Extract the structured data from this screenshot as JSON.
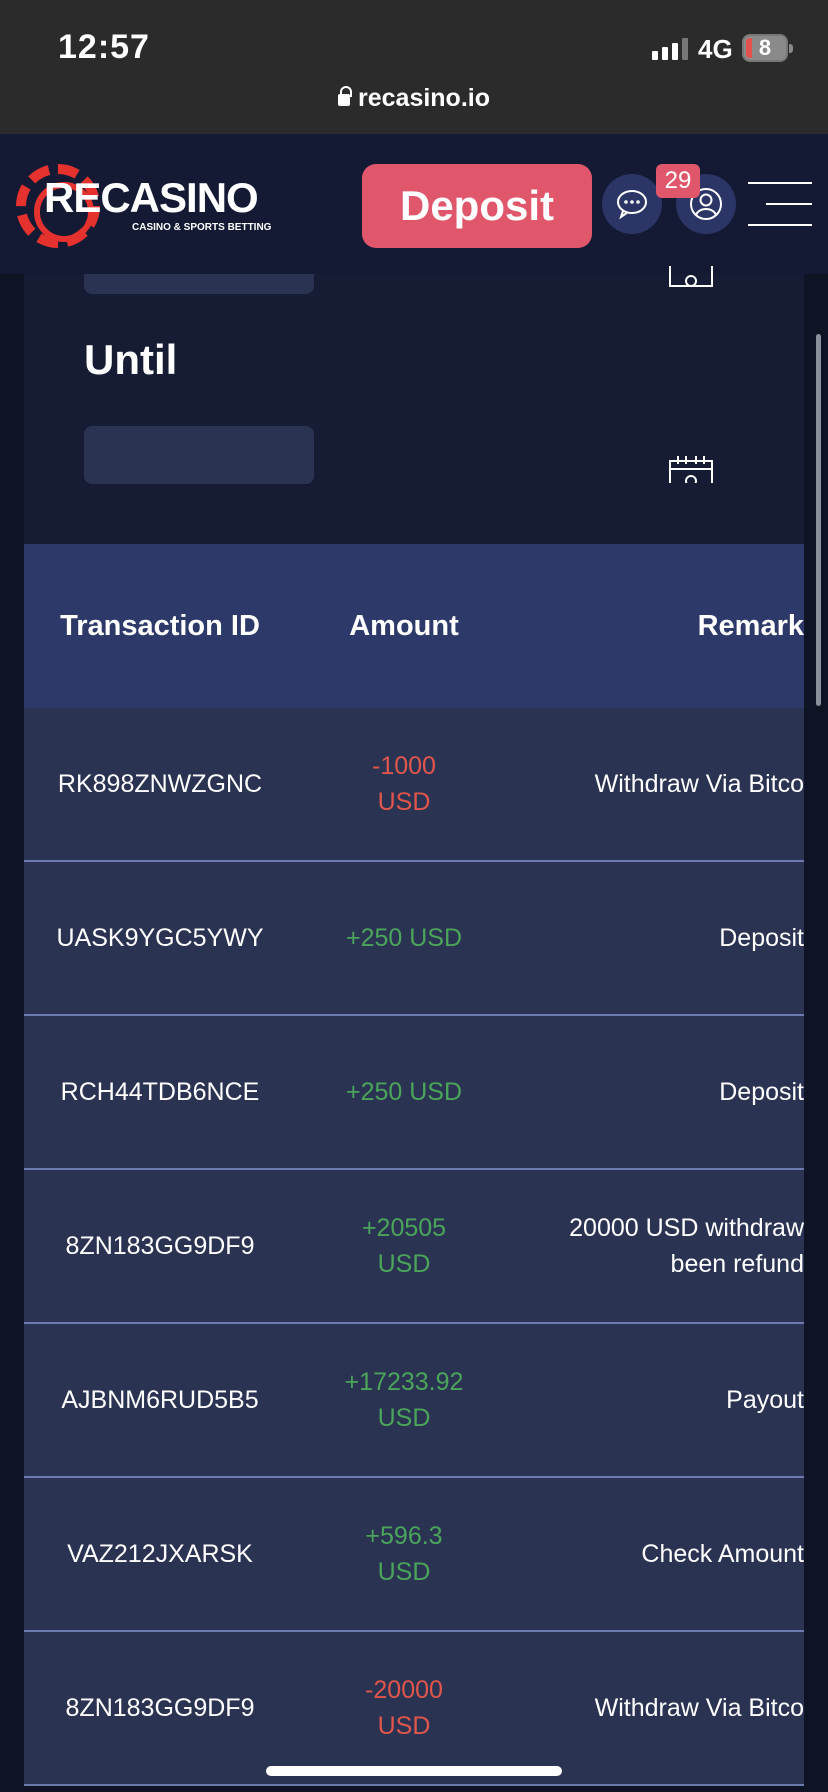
{
  "status_bar": {
    "time": "12:57",
    "network": "4G",
    "battery": "8",
    "url": "recasino.io"
  },
  "header": {
    "logo_text": "RECASINO",
    "logo_subtitle": "CASINO & SPORTS BETTING",
    "deposit_label": "Deposit",
    "notification_count": "29"
  },
  "filters": {
    "until_label": "Until"
  },
  "table": {
    "columns": [
      "Transaction ID",
      "Amount",
      "Remark"
    ],
    "rows": [
      {
        "id": "RK898ZNWZGNC",
        "amount_line1": "-1000",
        "amount_line2": "USD",
        "sign": "neg",
        "remark_line1": "Withdraw Via Bitco",
        "remark_line2": ""
      },
      {
        "id": "UASK9YGC5YWY",
        "amount_line1": "+250 USD",
        "amount_line2": "",
        "sign": "pos",
        "remark_line1": "Deposit",
        "remark_line2": ""
      },
      {
        "id": "RCH44TDB6NCE",
        "amount_line1": "+250 USD",
        "amount_line2": "",
        "sign": "pos",
        "remark_line1": "Deposit",
        "remark_line2": ""
      },
      {
        "id": "8ZN183GG9DF9",
        "amount_line1": "+20505",
        "amount_line2": "USD",
        "sign": "pos",
        "remark_line1": "20000 USD withdraw",
        "remark_line2": "been refund"
      },
      {
        "id": "AJBNM6RUD5B5",
        "amount_line1": "+17233.92",
        "amount_line2": "USD",
        "sign": "pos",
        "remark_line1": "Payout",
        "remark_line2": ""
      },
      {
        "id": "VAZ212JXARSK",
        "amount_line1": "+596.3",
        "amount_line2": "USD",
        "sign": "pos",
        "remark_line1": "Check Amount",
        "remark_line2": ""
      },
      {
        "id": "8ZN183GG9DF9",
        "amount_line1": "-20000",
        "amount_line2": "USD",
        "sign": "neg",
        "remark_line1": "Withdraw Via Bitco",
        "remark_line2": ""
      }
    ]
  },
  "colors": {
    "negative": "#e0564b",
    "positive": "#4aa55a",
    "accent": "#e0566b"
  }
}
